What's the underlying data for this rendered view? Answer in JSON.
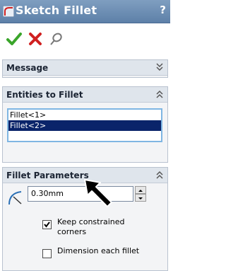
{
  "title": {
    "text": "Sketch Fillet",
    "help": "?"
  },
  "toolbar": {
    "ok": "check-icon",
    "cancel": "close-icon",
    "pushpin": "pushpin-icon"
  },
  "message_panel": {
    "title": "Message"
  },
  "entities_panel": {
    "title": "Entities to Fillet",
    "items": [
      "Fillet<1>",
      "Fillet<2>"
    ],
    "selected_index": 1
  },
  "parameters_panel": {
    "title": "Fillet Parameters",
    "radius": {
      "value": "0.30mm"
    },
    "keep_constrained": {
      "label": "Keep constrained corners",
      "checked": true
    },
    "dimension_each": {
      "label": "Dimension each fillet",
      "checked": false
    }
  },
  "colors": {
    "titlebar": "#5d80a8",
    "selection": "#0a246a",
    "ok": "#3aa52a",
    "cancel": "#d02020"
  }
}
